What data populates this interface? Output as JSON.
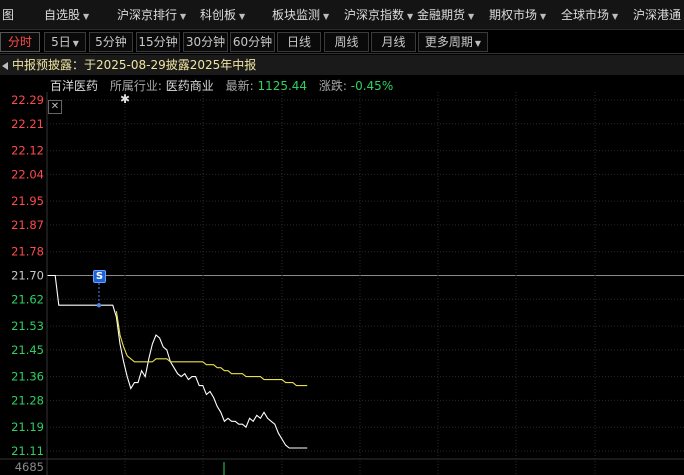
{
  "topbar": {
    "items": [
      {
        "label": "图",
        "caret": false
      },
      {
        "label": "自选股",
        "caret": true
      },
      {
        "label": "沪深京排行",
        "caret": true
      },
      {
        "label": "科创板",
        "caret": true
      },
      {
        "label": "板块监测",
        "caret": true
      },
      {
        "label": "沪深京指数",
        "caret": true
      },
      {
        "label": "金融期货",
        "caret": true
      },
      {
        "label": "期权市场",
        "caret": true
      },
      {
        "label": "全球市场",
        "caret": true
      },
      {
        "label": "沪深港通",
        "caret": false
      }
    ]
  },
  "tabs": [
    {
      "label": "分时",
      "active": true,
      "caret": false
    },
    {
      "label": "5日",
      "active": false,
      "caret": true
    },
    {
      "label": "5分钟",
      "active": false,
      "caret": false
    },
    {
      "label": "15分钟",
      "active": false,
      "caret": false
    },
    {
      "label": "30分钟",
      "active": false,
      "caret": false
    },
    {
      "label": "60分钟",
      "active": false,
      "caret": false
    },
    {
      "label": "日线",
      "active": false,
      "caret": false
    },
    {
      "label": "周线",
      "active": false,
      "caret": false
    },
    {
      "label": "月线",
      "active": false,
      "caret": false
    },
    {
      "label": "更多周期",
      "active": false,
      "caret": true
    }
  ],
  "announcement": {
    "text": "中报预披露：于2025-08-29披露2025年中报"
  },
  "stock_info": {
    "name": "百洋医药",
    "industry_label": "所属行业:",
    "industry_value": "医药商业",
    "latest_label": "最新:",
    "latest_value": "1125.44",
    "change_label": "涨跌:",
    "change_value": "-0.45%"
  },
  "chart_data": {
    "type": "line",
    "ylim": [
      21.11,
      22.29
    ],
    "y_ticks": [
      "22.29",
      "22.21",
      "22.12",
      "22.04",
      "21.95",
      "21.87",
      "21.78",
      "21.70",
      "21.62",
      "21.53",
      "21.45",
      "21.36",
      "21.28",
      "21.19",
      "21.11"
    ],
    "prev_close": 21.7,
    "volume_label": "4685",
    "series": [
      {
        "role": "price",
        "x": [
          0,
          1,
          2,
          3,
          4,
          5,
          6,
          7,
          8,
          9,
          10,
          11,
          12,
          13,
          14,
          15,
          16,
          17,
          18,
          19,
          20,
          21,
          22,
          23,
          24,
          25,
          26,
          27,
          28,
          29,
          30,
          31,
          32,
          33,
          34,
          35,
          36,
          37,
          38,
          39,
          40,
          41,
          42,
          43,
          44,
          45,
          46,
          47,
          48,
          49,
          50,
          51,
          52,
          53,
          54,
          55,
          56,
          57,
          58,
          59,
          60,
          61,
          62,
          63,
          64,
          65,
          66,
          67,
          68,
          69,
          70,
          71,
          72
        ],
        "values": [
          21.7,
          21.7,
          21.7,
          21.6,
          21.6,
          21.6,
          21.6,
          21.6,
          21.6,
          21.6,
          21.6,
          21.6,
          21.6,
          21.6,
          21.6,
          21.6,
          21.6,
          21.6,
          21.6,
          21.56,
          21.47,
          21.41,
          21.36,
          21.32,
          21.34,
          21.34,
          21.38,
          21.36,
          21.42,
          21.47,
          21.5,
          21.49,
          21.46,
          21.45,
          21.41,
          21.39,
          21.37,
          21.36,
          21.37,
          21.35,
          21.36,
          21.36,
          21.33,
          21.33,
          21.3,
          21.31,
          21.29,
          21.26,
          21.24,
          21.21,
          21.22,
          21.21,
          21.21,
          21.2,
          21.2,
          21.19,
          21.22,
          21.21,
          21.23,
          21.22,
          21.24,
          21.22,
          21.21,
          21.2,
          21.17,
          21.15,
          21.13,
          21.12,
          21.12,
          21.12,
          21.12,
          21.12,
          21.12
        ]
      },
      {
        "role": "average",
        "x": [
          19,
          20,
          21,
          22,
          23,
          24,
          25,
          26,
          27,
          28,
          29,
          30,
          31,
          32,
          33,
          34,
          35,
          36,
          37,
          38,
          39,
          40,
          41,
          42,
          43,
          44,
          45,
          46,
          47,
          48,
          49,
          50,
          51,
          52,
          53,
          54,
          55,
          56,
          57,
          58,
          59,
          60,
          61,
          62,
          63,
          64,
          65,
          66,
          67,
          68,
          69,
          70,
          71,
          72
        ],
        "values": [
          21.58,
          21.5,
          21.46,
          21.43,
          21.42,
          21.41,
          21.41,
          21.41,
          21.41,
          21.41,
          21.41,
          21.42,
          21.42,
          21.42,
          21.42,
          21.41,
          21.41,
          21.41,
          21.41,
          21.41,
          21.41,
          21.41,
          21.41,
          21.41,
          21.41,
          21.4,
          21.4,
          21.4,
          21.39,
          21.39,
          21.38,
          21.38,
          21.37,
          21.37,
          21.37,
          21.37,
          21.36,
          21.36,
          21.36,
          21.36,
          21.36,
          21.35,
          21.35,
          21.35,
          21.35,
          21.35,
          21.35,
          21.34,
          21.34,
          21.34,
          21.33,
          21.33,
          21.33,
          21.33
        ]
      }
    ],
    "markers": [
      {
        "label": "S",
        "x": 12
      },
      {
        "label": "✱",
        "x": 19
      }
    ],
    "grid": true,
    "colors": {
      "up": "#ff4a4a",
      "down": "#2fd061",
      "neutral": "#c8c8c8",
      "price_line": "#ffffff",
      "avg_line": "#e8e04a",
      "grid": "#2a2a2a"
    }
  }
}
